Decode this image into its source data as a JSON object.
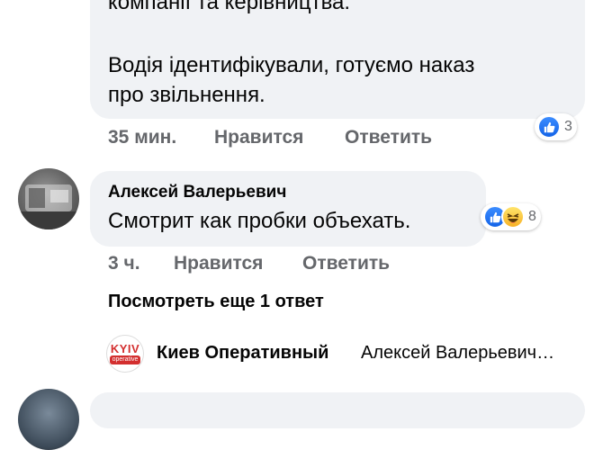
{
  "comment1": {
    "lines": [
      "компанії та керівництва.",
      "Водія ідентифікували, готуємо наказ",
      "про звільнення."
    ],
    "time": "35 мин.",
    "like_label": "Нравится",
    "reply_label": "Ответить",
    "reaction_icons": [
      "like-icon"
    ],
    "reaction_count": "3"
  },
  "comment2": {
    "author": "Алексей Валерьевич",
    "text": "Смотрит как пробки объехать.",
    "time": "3 ч.",
    "like_label": "Нравится",
    "reply_label": "Ответить",
    "reaction_icons": [
      "like-icon",
      "haha-icon"
    ],
    "reaction_count": "8",
    "more_replies": "Посмотреть еще 1 ответ"
  },
  "reply_preview": {
    "logo_text": "KYIV",
    "logo_sub": "operative",
    "author": "Киев Оперативный",
    "text": "Алексей Валерьевич…"
  },
  "colors": {
    "bubble": "#f0f2f5",
    "meta_text": "#65676b",
    "like_blue": "#1877f2",
    "logo_red": "#d32f2f"
  }
}
